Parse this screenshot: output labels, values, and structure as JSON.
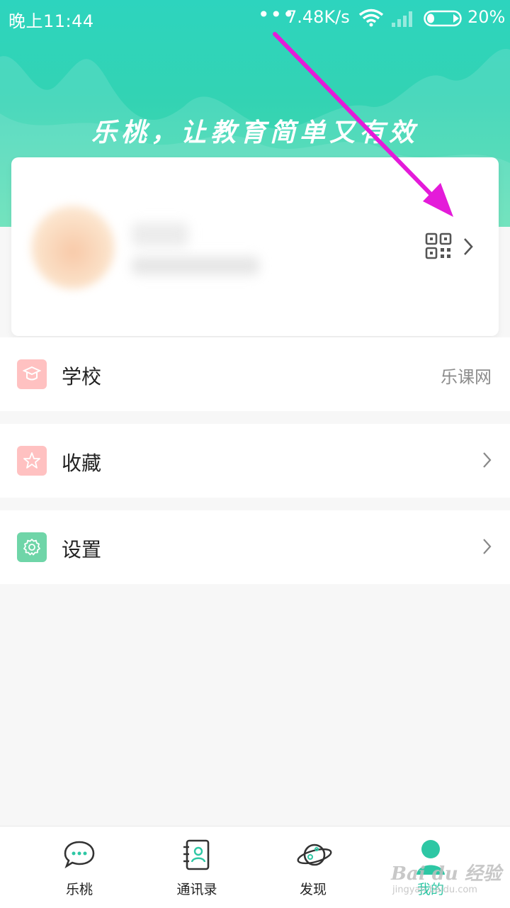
{
  "status_bar": {
    "time": "晚上11:44",
    "dots": "•••",
    "net_speed": "7.48K/s",
    "battery_pct": "20%",
    "icons": [
      "wifi-icon",
      "signal-icon",
      "battery-icon"
    ]
  },
  "header": {
    "slogan": "乐桃，让教育简单又有效",
    "color_top": "#2dd4be",
    "color_bottom": "#4fdcae"
  },
  "profile": {
    "avatar": "blurred",
    "name": "",
    "subtitle": "",
    "qr_icon": "qr-code-icon",
    "chevron_icon": "chevron-right-icon"
  },
  "menu": {
    "school": {
      "label": "学校",
      "value": "乐课网",
      "icon": "graduation-cap-icon",
      "icon_bg": "#ffc1c1"
    },
    "favorites": {
      "label": "收藏",
      "icon": "star-icon",
      "icon_bg": "#ffc1c1"
    },
    "settings": {
      "label": "设置",
      "icon": "gear-icon",
      "icon_bg": "#6fd5a8"
    }
  },
  "bottom_nav": {
    "items": [
      {
        "label": "乐桃",
        "icon": "chat-bubble-icon"
      },
      {
        "label": "通讯录",
        "icon": "contacts-icon"
      },
      {
        "label": "发现",
        "icon": "planet-icon"
      },
      {
        "label": "我的",
        "icon": "profile-icon",
        "active": true
      }
    ],
    "accent": "#2dc7a4"
  },
  "watermark": {
    "text": "Bai du 经验",
    "sub": "jingyan.baidu.com"
  },
  "annotation": {
    "arrow_color": "#e41bd9"
  }
}
